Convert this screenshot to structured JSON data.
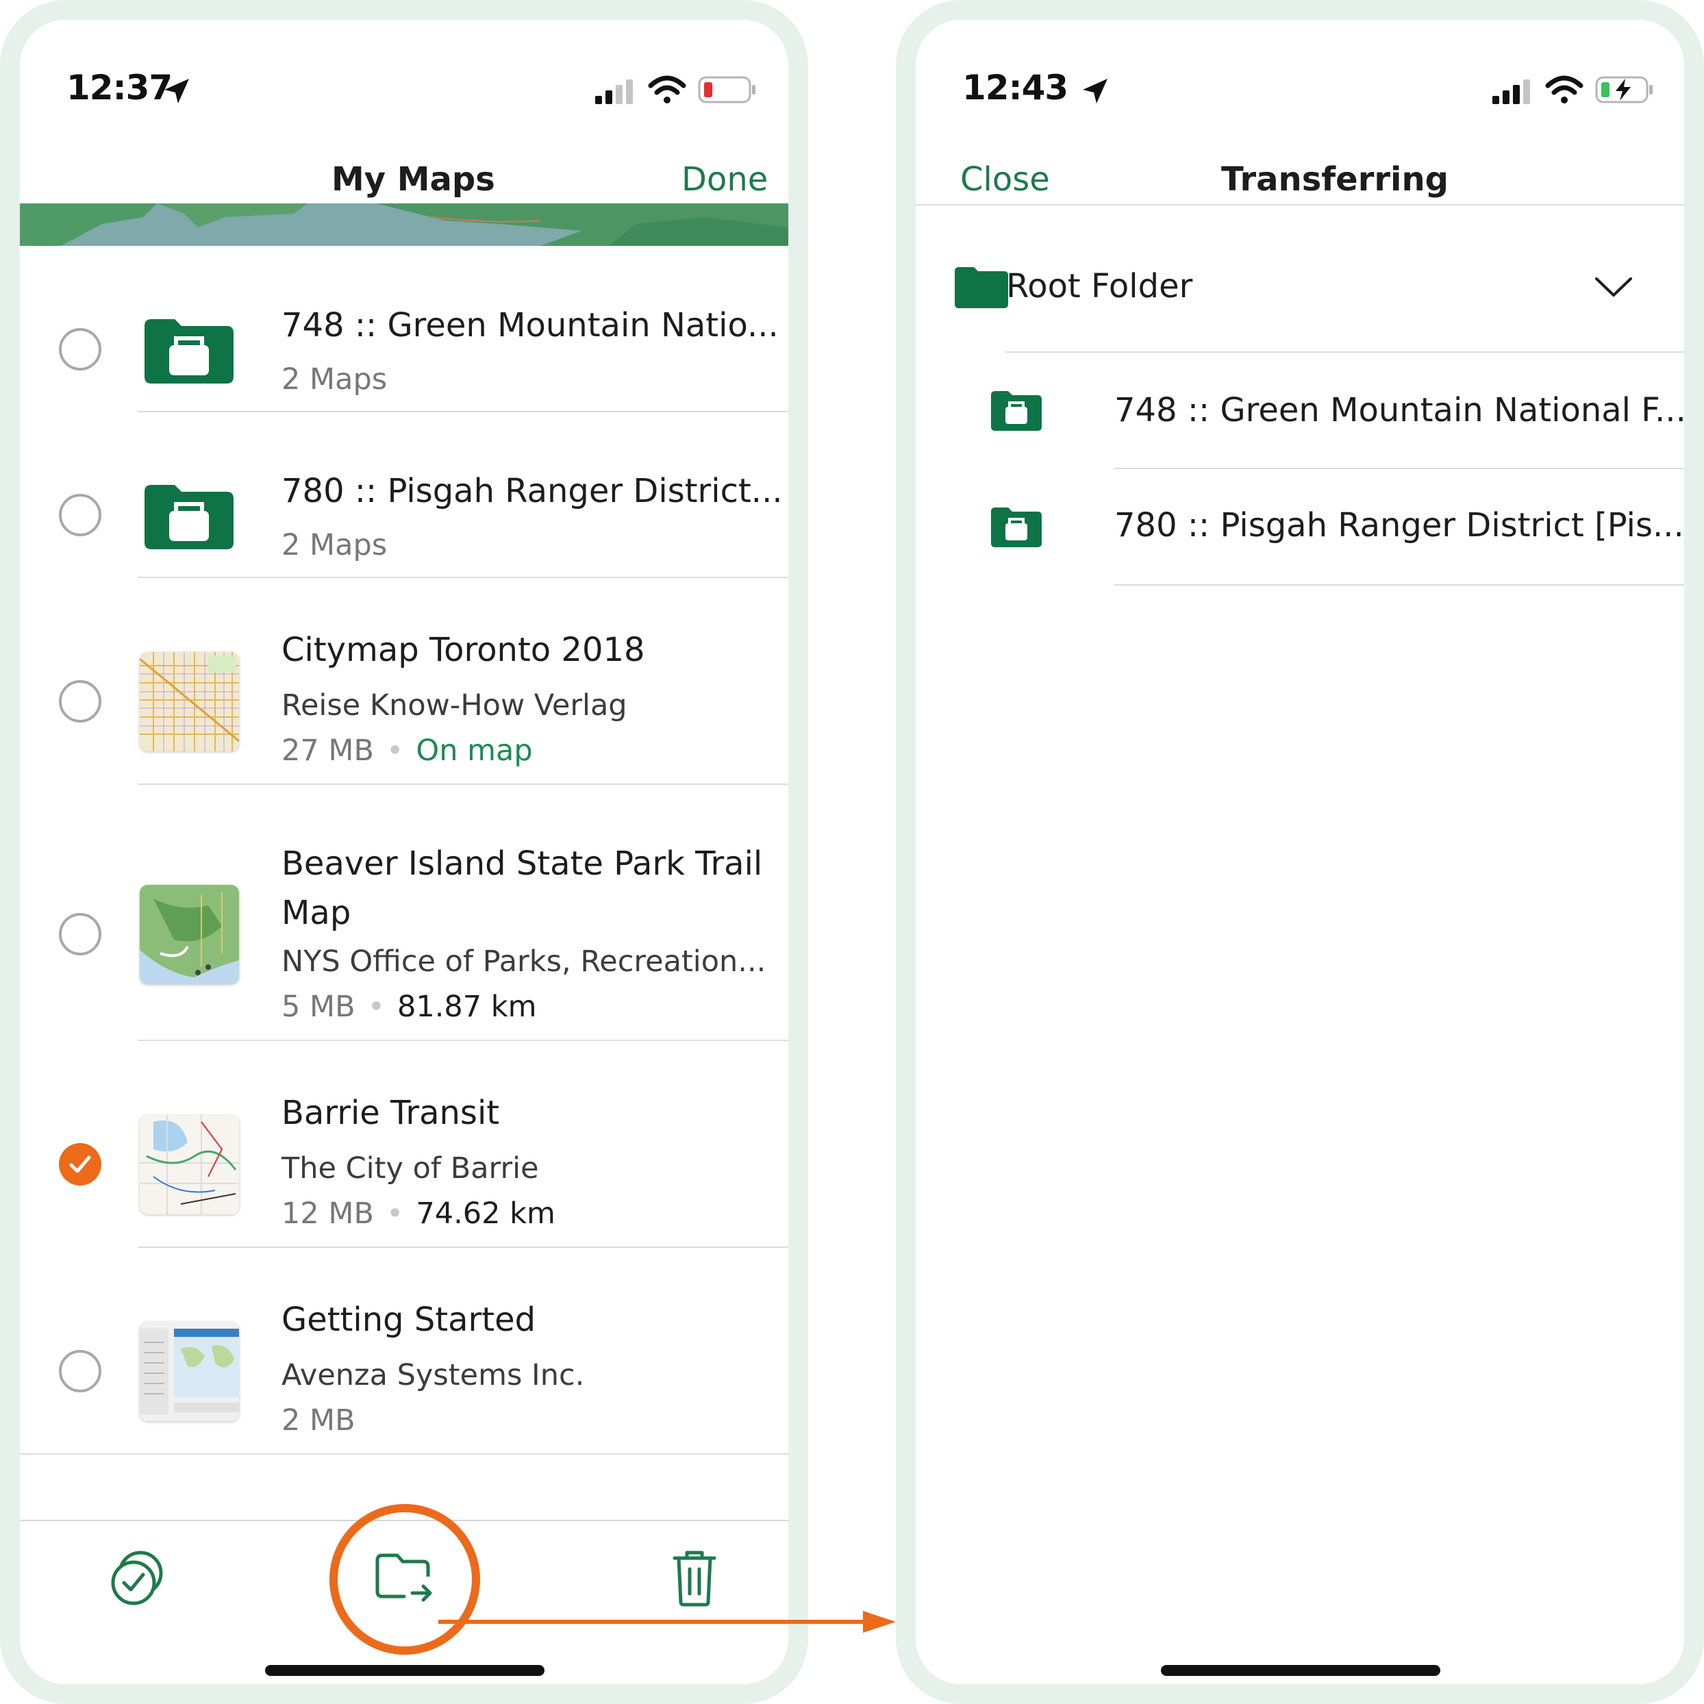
{
  "left_phone": {
    "status_time": "12:37",
    "nav": {
      "title": "My Maps",
      "done_label": "Done"
    },
    "items": [
      {
        "title": "748 :: Green Mountain Natio...",
        "subtitle": "2 Maps"
      },
      {
        "title": "780 :: Pisgah Ranger District...",
        "subtitle": "2 Maps"
      },
      {
        "title": "Citymap Toronto 2018",
        "publisher": "Reise Know-How Verlag",
        "size": "27 MB",
        "status": "On map"
      },
      {
        "title_line1": "Beaver Island State Park Trail",
        "title_line2": "Map",
        "publisher": "NYS Office of Parks, Recreation...",
        "size": "5 MB",
        "distance": "81.87 km"
      },
      {
        "title": "Barrie Transit",
        "publisher": "The City of Barrie",
        "size": "12 MB",
        "distance": "74.62 km",
        "selected": true
      },
      {
        "title": "Getting Started",
        "publisher": "Avenza Systems Inc.",
        "size": "2 MB"
      }
    ],
    "toolbar": {
      "select_all_icon": "select-all-icon",
      "move_icon": "folder-move-icon",
      "delete_icon": "trash-icon"
    }
  },
  "right_phone": {
    "status_time": "12:43",
    "nav": {
      "close_label": "Close",
      "title": "Transferring"
    },
    "root_folder": "Root Folder",
    "subfolders": [
      "748 :: Green Mountain National F...",
      "780 :: Pisgah Ranger District [Pis..."
    ]
  },
  "colors": {
    "accent_green": "#1d7a4c",
    "folder_green": "#0e7346",
    "highlight_orange": "#ec6a1a",
    "phone_border": "#e6f1ec"
  }
}
